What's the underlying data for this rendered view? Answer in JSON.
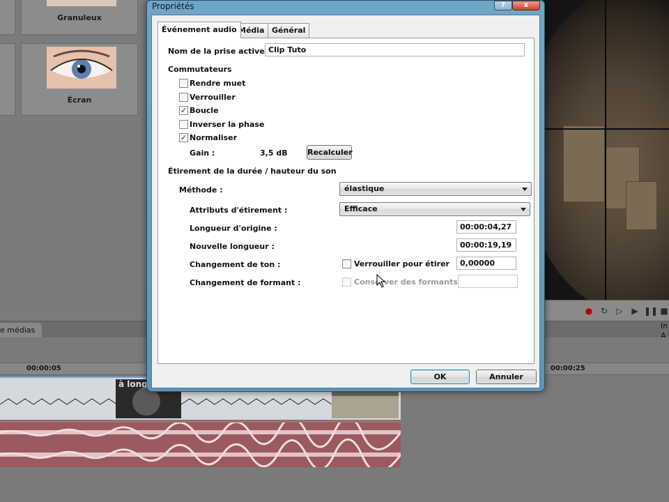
{
  "background": {
    "effects": [
      {
        "label": "Granuleux"
      },
      {
        "label": "Écran"
      }
    ],
    "panel_tab": "e médias",
    "corner_label": "In\nA",
    "ruler_labels": [
      "00:00:05",
      "00:00:25"
    ],
    "clip_overlay_text": "à longu"
  },
  "dialog": {
    "title": "Propriétés",
    "help_label": "?",
    "close_label": "x",
    "tabs": [
      {
        "label": "Événement audio",
        "active": true
      },
      {
        "label": "Média",
        "active": false
      },
      {
        "label": "Général",
        "active": false
      }
    ],
    "active_take": {
      "label": "Nom de la prise active :",
      "value": "Clip Tuto"
    },
    "switches": {
      "title": "Commutateurs",
      "items": [
        {
          "label": "Rendre muet",
          "checked": false
        },
        {
          "label": "Verrouiller",
          "checked": false
        },
        {
          "label": "Boucle",
          "checked": true
        },
        {
          "label": "Inverser la phase",
          "checked": false
        },
        {
          "label": "Normaliser",
          "checked": true
        }
      ],
      "gain_label": "Gain :",
      "gain_value": "3,5 dB",
      "recalc_button": "Recalculer"
    },
    "stretch": {
      "title": "Étirement de la durée / hauteur du son",
      "method_label": "Méthode :",
      "method_value": "élastique",
      "attributes_label": "Attributs d'étirement :",
      "attributes_value": "Efficace",
      "original_length_label": "Longueur d'origine :",
      "original_length_value": "00:00:04,27",
      "new_length_label": "Nouvelle longueur :",
      "new_length_value": "00:00:19,19",
      "pitch_label": "Changement de ton :",
      "pitch_lock_label": "Verrouiller pour étirer",
      "pitch_lock_checked": false,
      "pitch_value": "0,00000",
      "formant_label": "Changement de formant :",
      "formant_keep_label": "Conserver des formants",
      "formant_keep_checked": false,
      "formant_value": ""
    },
    "ok_button": "OK",
    "cancel_button": "Annuler"
  },
  "colors": {
    "dialog_frame": "#6fa6c8",
    "video_track": "#d5d8dc",
    "audio_track": "#9a5a5e",
    "waveform": "#e3c3c5"
  }
}
